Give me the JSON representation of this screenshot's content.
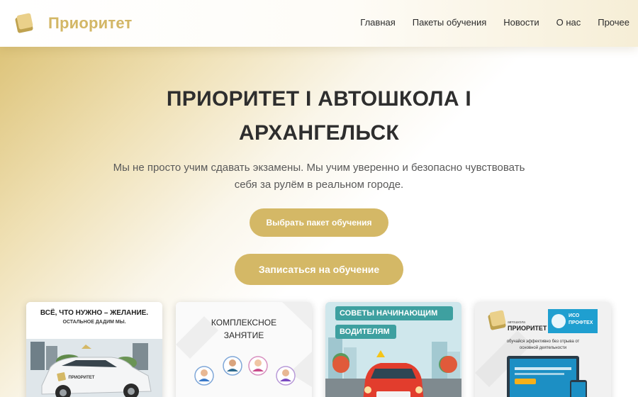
{
  "header": {
    "brand": "Приоритет",
    "nav": [
      "Главная",
      "Пакеты обучения",
      "Новости",
      "О нас",
      "Прочее"
    ]
  },
  "hero": {
    "title_line1": "ПРИОРИТЕТ I АВТОШКОЛА I",
    "title_line2": "АРХАНГЕЛЬСК",
    "subtitle_line1": "Мы не просто учим сдавать экзамены. Мы учим уверенно и безопасно чувствовать",
    "subtitle_line2": "себя за рулём в реальном городе.",
    "primary_button": "Выбрать пакет обучения",
    "secondary_button": "Записаться на обучение"
  },
  "cards": [
    {
      "headline": "ВСЁ, ЧТО НУЖНО – ЖЕЛАНИЕ.",
      "subline": "ОСТАЛЬНОЕ ДАДИМ МЫ.",
      "car_label": "ПРИОРИТЕТ"
    },
    {
      "headline_line1": "КОМПЛЕКСНОЕ",
      "headline_line2": "ЗАНЯТИЕ"
    },
    {
      "headline_line1": "СОВЕТЫ НАЧИНАЮЩИМ",
      "headline_line2": "ВОДИТЕЛЯМ"
    },
    {
      "brand_small": "автошкола",
      "brand": "ПРИОРИТЕТ",
      "partner_line1": "ИСО",
      "partner_line2": "ПРОФТЕХ",
      "caption_line1": "обучайся эффективно без отрыва от",
      "caption_line2": "основной деятельности"
    }
  ],
  "colors": {
    "accent": "#d4b866",
    "brand": "#d3b766",
    "text": "#2e2e2e"
  }
}
